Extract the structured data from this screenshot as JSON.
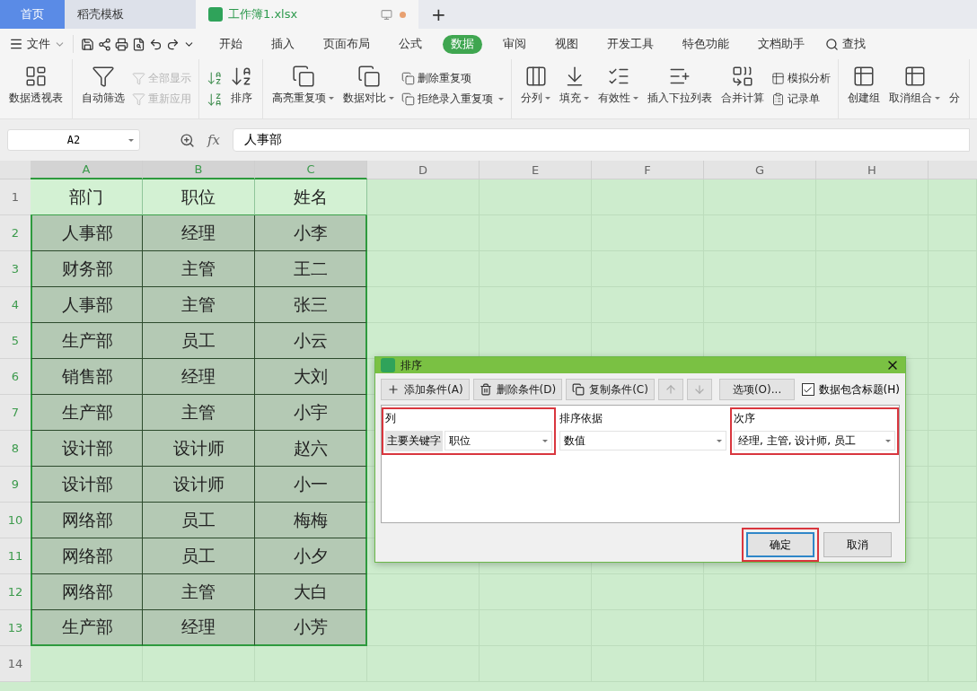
{
  "tabs": [
    {
      "label": "首页",
      "selected": false,
      "kind": "home"
    },
    {
      "label": "稻壳模板",
      "selected": false,
      "kind": "template"
    },
    {
      "label": "工作簿1.xlsx",
      "selected": true,
      "kind": "sheet"
    }
  ],
  "new_tab": "+",
  "menu": {
    "file": "文件",
    "items": [
      {
        "label": "开始",
        "selected": false
      },
      {
        "label": "插入",
        "selected": false
      },
      {
        "label": "页面布局",
        "selected": false
      },
      {
        "label": "公式",
        "selected": false
      },
      {
        "label": "数据",
        "selected": true
      },
      {
        "label": "审阅",
        "selected": false
      },
      {
        "label": "视图",
        "selected": false
      },
      {
        "label": "开发工具",
        "selected": false
      },
      {
        "label": "特色功能",
        "selected": false
      },
      {
        "label": "文档助手",
        "selected": false
      }
    ],
    "search": "查找"
  },
  "ribbon": [
    [
      {
        "kind": "large",
        "label": "数据透视表",
        "dropdown": false
      }
    ],
    [
      {
        "kind": "large",
        "label": "自动筛选",
        "dropdown": false
      },
      {
        "kind": "stack",
        "items": [
          {
            "label": "全部显示",
            "disabled": true,
            "dropdown": false
          },
          {
            "label": "重新应用",
            "disabled": true,
            "dropdown": false
          }
        ]
      }
    ],
    [
      {
        "kind": "sort_icons"
      },
      {
        "kind": "large",
        "label": "排序",
        "dropdown": false
      }
    ],
    [
      {
        "kind": "large",
        "label": "高亮重复项",
        "dropdown": true
      },
      {
        "kind": "large",
        "label": "数据对比",
        "dropdown": true
      },
      {
        "kind": "stack",
        "items": [
          {
            "label": "删除重复项",
            "disabled": false,
            "dropdown": false
          },
          {
            "label": "拒绝录入重复项",
            "disabled": false,
            "dropdown": true
          }
        ]
      }
    ],
    [
      {
        "kind": "large",
        "label": "分列",
        "dropdown": true
      },
      {
        "kind": "large",
        "label": "填充",
        "dropdown": true
      },
      {
        "kind": "large",
        "label": "有效性",
        "dropdown": true
      },
      {
        "kind": "large",
        "label": "插入下拉列表",
        "dropdown": false
      },
      {
        "kind": "large",
        "label": "合并计算",
        "dropdown": false
      },
      {
        "kind": "stack",
        "items": [
          {
            "label": "模拟分析",
            "disabled": false,
            "dropdown": false
          },
          {
            "label": "记录单",
            "disabled": false,
            "dropdown": false
          }
        ]
      }
    ],
    [
      {
        "kind": "large",
        "label": "创建组",
        "dropdown": false
      },
      {
        "kind": "large",
        "label": "取消组合",
        "dropdown": true
      },
      {
        "kind": "cut",
        "label": "分"
      }
    ]
  ],
  "formula_bar": {
    "name_box": "A2",
    "fx": "fx",
    "value": "人事部"
  },
  "sheet": {
    "columns": [
      {
        "label": "A",
        "selected": true
      },
      {
        "label": "B",
        "selected": true
      },
      {
        "label": "C",
        "selected": true
      },
      {
        "label": "D",
        "selected": false
      },
      {
        "label": "E",
        "selected": false
      },
      {
        "label": "F",
        "selected": false
      },
      {
        "label": "G",
        "selected": false
      },
      {
        "label": "H",
        "selected": false
      }
    ],
    "rows": [
      {
        "number": "1",
        "selected": false,
        "cells": [
          "部门",
          "职位",
          "姓名"
        ]
      },
      {
        "number": "2",
        "selected": true,
        "cells": [
          "人事部",
          "经理",
          "小李"
        ]
      },
      {
        "number": "3",
        "selected": true,
        "cells": [
          "财务部",
          "主管",
          "王二"
        ]
      },
      {
        "number": "4",
        "selected": true,
        "cells": [
          "人事部",
          "主管",
          "张三"
        ]
      },
      {
        "number": "5",
        "selected": true,
        "cells": [
          "生产部",
          "员工",
          "小云"
        ]
      },
      {
        "number": "6",
        "selected": true,
        "cells": [
          "销售部",
          "经理",
          "大刘"
        ]
      },
      {
        "number": "7",
        "selected": true,
        "cells": [
          "生产部",
          "主管",
          "小宇"
        ]
      },
      {
        "number": "8",
        "selected": true,
        "cells": [
          "设计部",
          "设计师",
          "赵六"
        ]
      },
      {
        "number": "9",
        "selected": true,
        "cells": [
          "设计部",
          "设计师",
          "小一"
        ]
      },
      {
        "number": "10",
        "selected": true,
        "cells": [
          "网络部",
          "员工",
          "梅梅"
        ]
      },
      {
        "number": "11",
        "selected": true,
        "cells": [
          "网络部",
          "员工",
          "小夕"
        ]
      },
      {
        "number": "12",
        "selected": true,
        "cells": [
          "网络部",
          "主管",
          "大白"
        ]
      },
      {
        "number": "13",
        "selected": true,
        "cells": [
          "生产部",
          "经理",
          "小芳"
        ]
      },
      {
        "number": "14",
        "selected": false,
        "cells": []
      }
    ]
  },
  "dialog": {
    "title": "排序",
    "toolbar": [
      {
        "kind": "text",
        "label": "添加条件(A)",
        "disabled": false
      },
      {
        "kind": "text",
        "label": "删除条件(D)",
        "disabled": false
      },
      {
        "kind": "text",
        "label": "复制条件(C)",
        "disabled": false
      },
      {
        "kind": "icon",
        "disabled": true
      },
      {
        "kind": "icon",
        "disabled": true
      },
      {
        "kind": "plain",
        "label": "选项(O)...",
        "disabled": false
      }
    ],
    "header_checkbox": {
      "label": "数据包含标题(H)",
      "checked": true
    },
    "columns": [
      {
        "heading": "列",
        "annotated": true
      },
      {
        "heading": "排序依据",
        "annotated": false
      },
      {
        "heading": "次序",
        "annotated": true
      }
    ],
    "condition": {
      "label": "主要关键字",
      "column": "职位",
      "basis": "数值",
      "order": "经理, 主管, 设计师, 员工"
    },
    "buttons": [
      {
        "label": "确定",
        "primary": true,
        "annotated": true
      },
      {
        "label": "取消",
        "primary": false,
        "annotated": false
      }
    ]
  }
}
